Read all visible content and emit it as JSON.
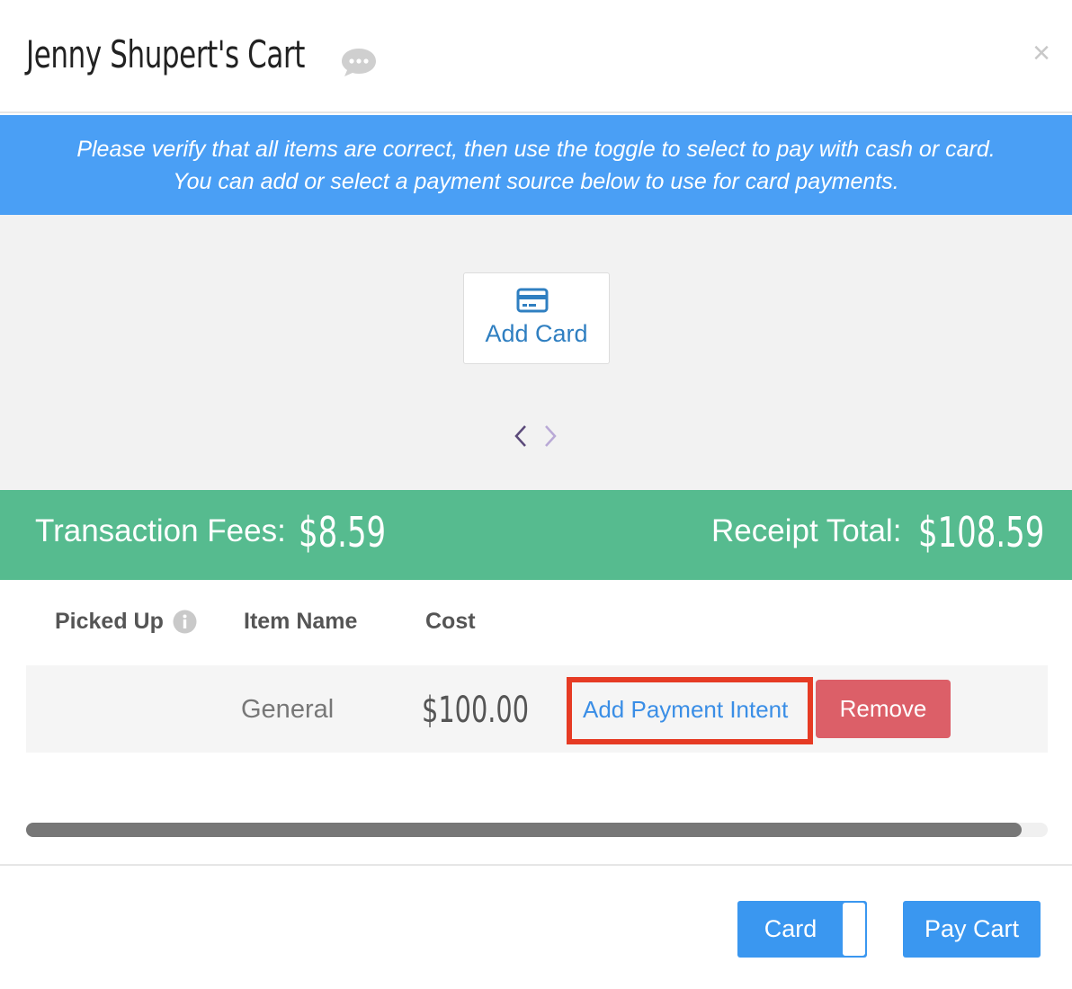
{
  "header": {
    "title": "Jenny Shupert's Cart",
    "chat_icon": "speech-bubble-icon",
    "close_label": "×"
  },
  "banner": {
    "line1": "Please verify that all items are correct, then use the toggle to select to pay with cash or card.",
    "line2": "You can add or select a payment source below to use for card payments."
  },
  "card_area": {
    "add_card_label": "Add Card",
    "add_card_icon": "credit-card-icon",
    "prev_icon": "chevron-left-icon",
    "next_icon": "chevron-right-icon"
  },
  "totals": {
    "fees_label": "Transaction Fees:",
    "fees_value": "$8.59",
    "receipt_label": "Receipt Total:",
    "receipt_value": "$108.59"
  },
  "table": {
    "columns": [
      "Picked Up",
      "Item Name",
      "Cost"
    ],
    "rows": [
      {
        "item_name": "General",
        "cost": "$100.00",
        "payment_intent_label": "Add Payment Intent",
        "remove_label": "Remove"
      }
    ]
  },
  "scrollbar": {
    "position": 1.0
  },
  "footer": {
    "toggle_label": "Card",
    "pay_label": "Pay Cart"
  },
  "colors": {
    "banner": "#4a9ff5",
    "totals": "#56bb8f",
    "primary": "#3a97f0",
    "danger": "#dc5f68",
    "highlight": "#e63b24"
  }
}
